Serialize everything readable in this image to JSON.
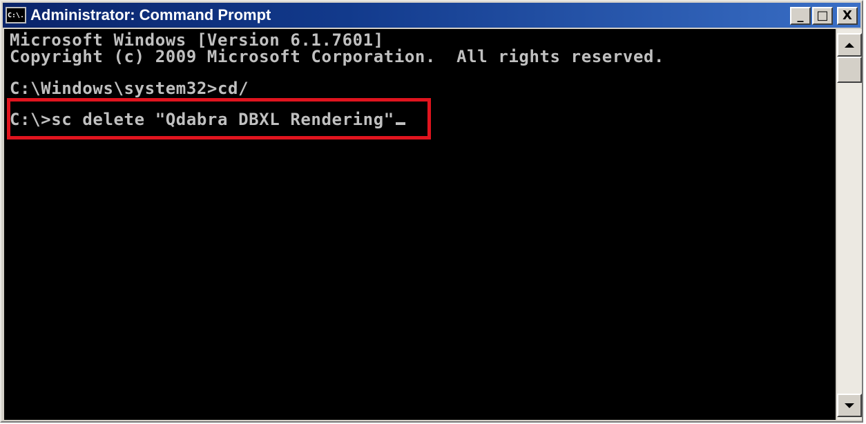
{
  "window": {
    "title": "Administrator: Command Prompt",
    "icon_label": "C:\\.",
    "buttons": {
      "minimize": "_",
      "maximize": "□",
      "close": "X"
    }
  },
  "console": {
    "lines": [
      "Microsoft Windows [Version 6.1.7601]",
      "Copyright (c) 2009 Microsoft Corporation.  All rights reserved.",
      "",
      "C:\\Windows\\system32>cd/",
      "",
      "C:\\>sc delete \"Qdabra DBXL Rendering\""
    ],
    "highlight_color": "#e0141e",
    "text_color": "#c0c0c0",
    "background_color": "#000000"
  },
  "scrollbar": {
    "up_icon": "triangle-up",
    "down_icon": "triangle-down"
  }
}
